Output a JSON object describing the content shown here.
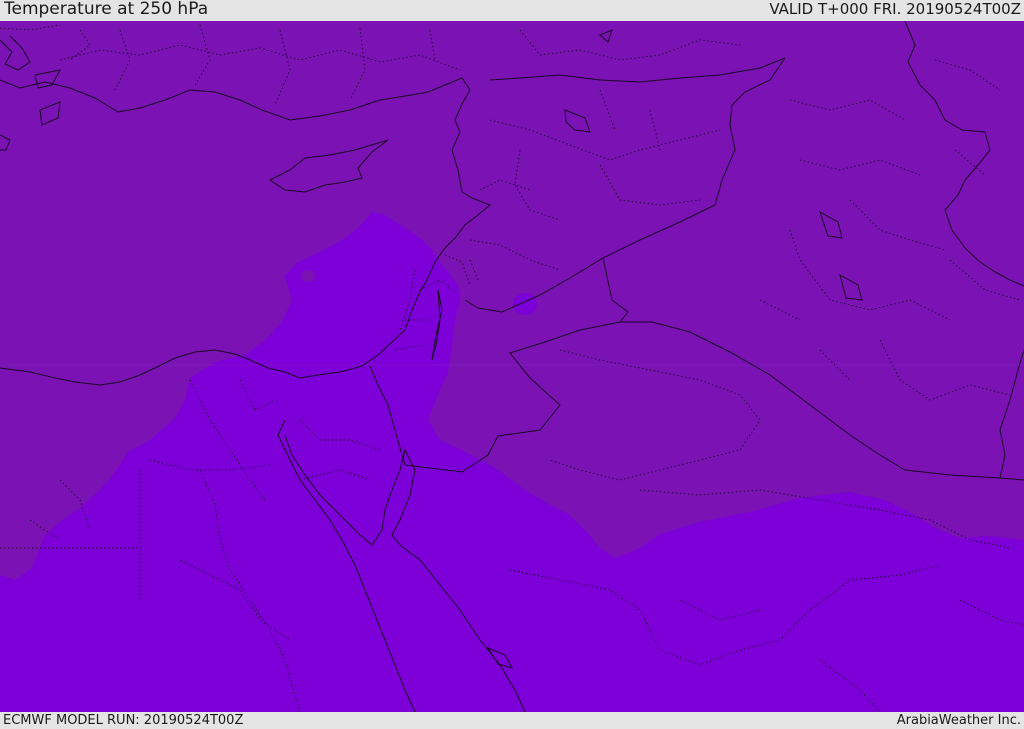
{
  "header": {
    "title": "Temperature at 250 hPa",
    "valid": "VALID T+000 FRI. 20190524T00Z"
  },
  "footer": {
    "model_run": "ECMWF MODEL RUN: 20190524T00Z",
    "credit": "ArabiaWeather Inc."
  },
  "colors": {
    "warm_band": "#7a12b4",
    "cool_band": "#7d00d8",
    "lines": "#1a0826",
    "frame": "#e4e4e4"
  }
}
